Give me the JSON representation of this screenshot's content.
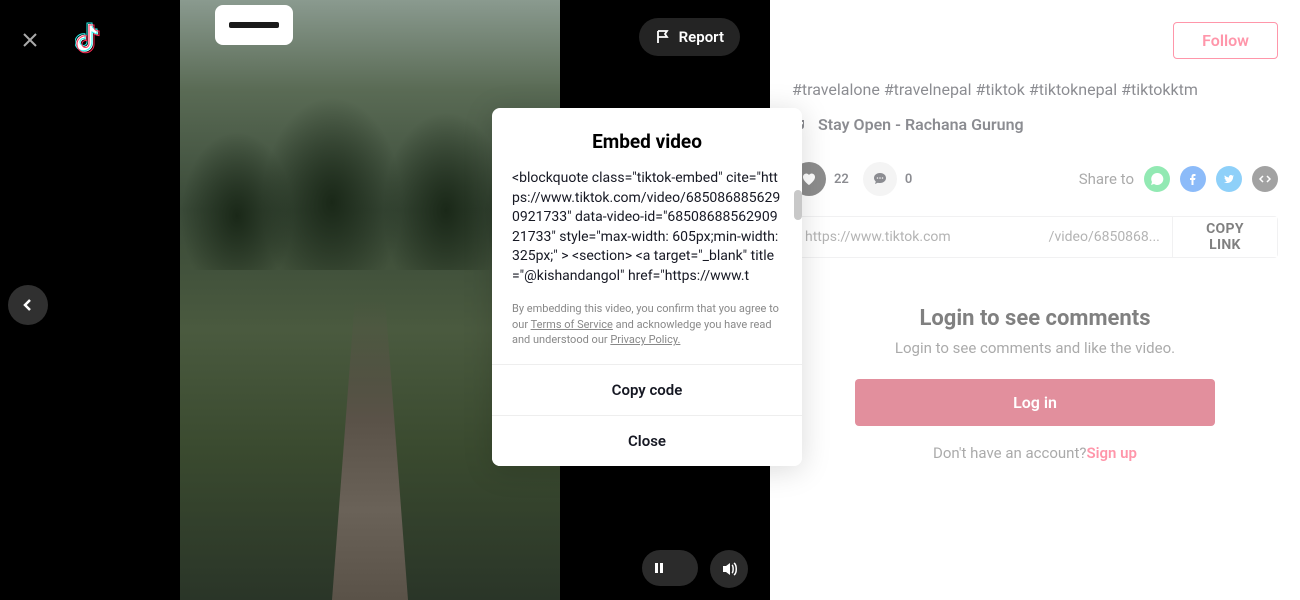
{
  "header": {
    "report_label": "Report"
  },
  "user": {
    "follow_label": "Follow"
  },
  "post": {
    "hashtags": "#travelalone #travelnepal #tiktok #tiktoknepal #tiktokktm",
    "music": "Stay Open - Rachana Gurung"
  },
  "stats": {
    "likes": "22",
    "comments": "0"
  },
  "share": {
    "label": "Share to"
  },
  "link": {
    "prefix": "https://www.tiktok.com",
    "suffix": "/video/6850868...",
    "copy_label": "COPY LINK"
  },
  "login": {
    "title": "Login to see comments",
    "subtitle": "Login to see comments and like the video.",
    "button": "Log in",
    "prompt": "Don't have an account?",
    "signup": "Sign up"
  },
  "modal": {
    "title": "Embed video",
    "code": "<blockquote class=\"tiktok-embed\" cite=\"https://www.tiktok.com/video/6850868856290921733\" data-video-id=\"6850868856290921733\" style=\"max-width: 605px;min-width: 325px;\" > <section> <a target=\"_blank\" title=\"@kishandangol\" href=\"https://www.t",
    "disclaimer_prefix": "By embedding this video, you confirm that you agree to our ",
    "tos": "Terms of Service",
    "disclaimer_mid": " and acknowledge you have read and understood our ",
    "privacy": "Privacy Policy.",
    "copy_btn": "Copy code",
    "close_btn": "Close"
  }
}
